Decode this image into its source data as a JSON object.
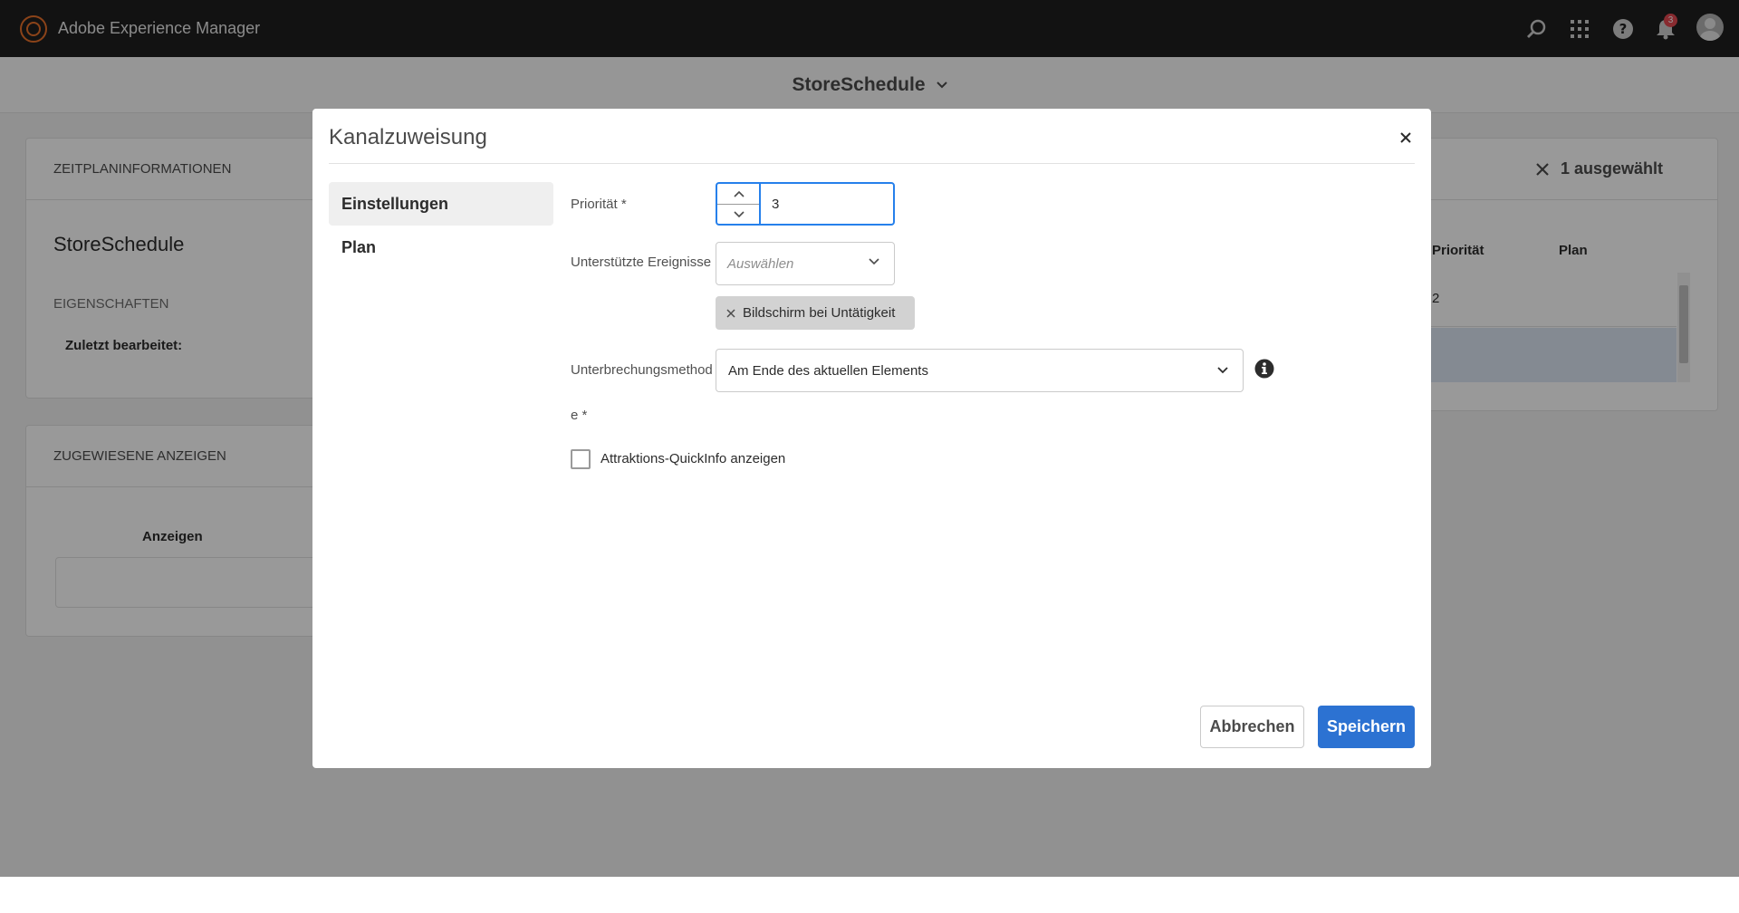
{
  "app": {
    "title": "Adobe Experience Manager"
  },
  "topbar": {
    "notification_count": "3",
    "icons": [
      "search-icon",
      "apps-grid-icon",
      "help-icon",
      "bell-icon",
      "avatar"
    ]
  },
  "subbar": {
    "title": "StoreSchedule"
  },
  "info_card": {
    "header": "ZEITPLANINFORMATIONEN",
    "name": "StoreSchedule",
    "section": "EIGENSCHAFTEN",
    "last_edited_label": "Zuletzt bearbeitet:"
  },
  "assigned_card": {
    "header": "ZUGEWIESENE ANZEIGEN",
    "column": "Anzeigen"
  },
  "channels_card": {
    "selected_text": "1 ausgewählt",
    "columns": [
      "Priorität",
      "Plan"
    ],
    "row1_priority": "2"
  },
  "dialog": {
    "title": "Kanalzuweisung",
    "tabs": [
      "Einstellungen",
      "Plan"
    ],
    "fields": {
      "priority_label": "Priorität *",
      "priority_value": "3",
      "events_label": "Unterstützte Ereignisse",
      "events_placeholder": "Auswählen",
      "events_tag": "Bildschirm bei Untätigkeit",
      "interrupt_label_line1": "Unterbrechungsmethod",
      "interrupt_label_line2": "e *",
      "interrupt_value": "Am Ende des aktuellen Elements",
      "checkbox_label": "Attraktions-QuickInfo anzeigen",
      "checkbox_checked": false
    },
    "buttons": {
      "cancel": "Abbrechen",
      "save": "Speichern"
    }
  },
  "colors": {
    "accent": "#2c72d2",
    "focus": "#2680eb",
    "topbar": "#1e1e1e",
    "logo": "#e8702a",
    "badge": "#e34850"
  }
}
